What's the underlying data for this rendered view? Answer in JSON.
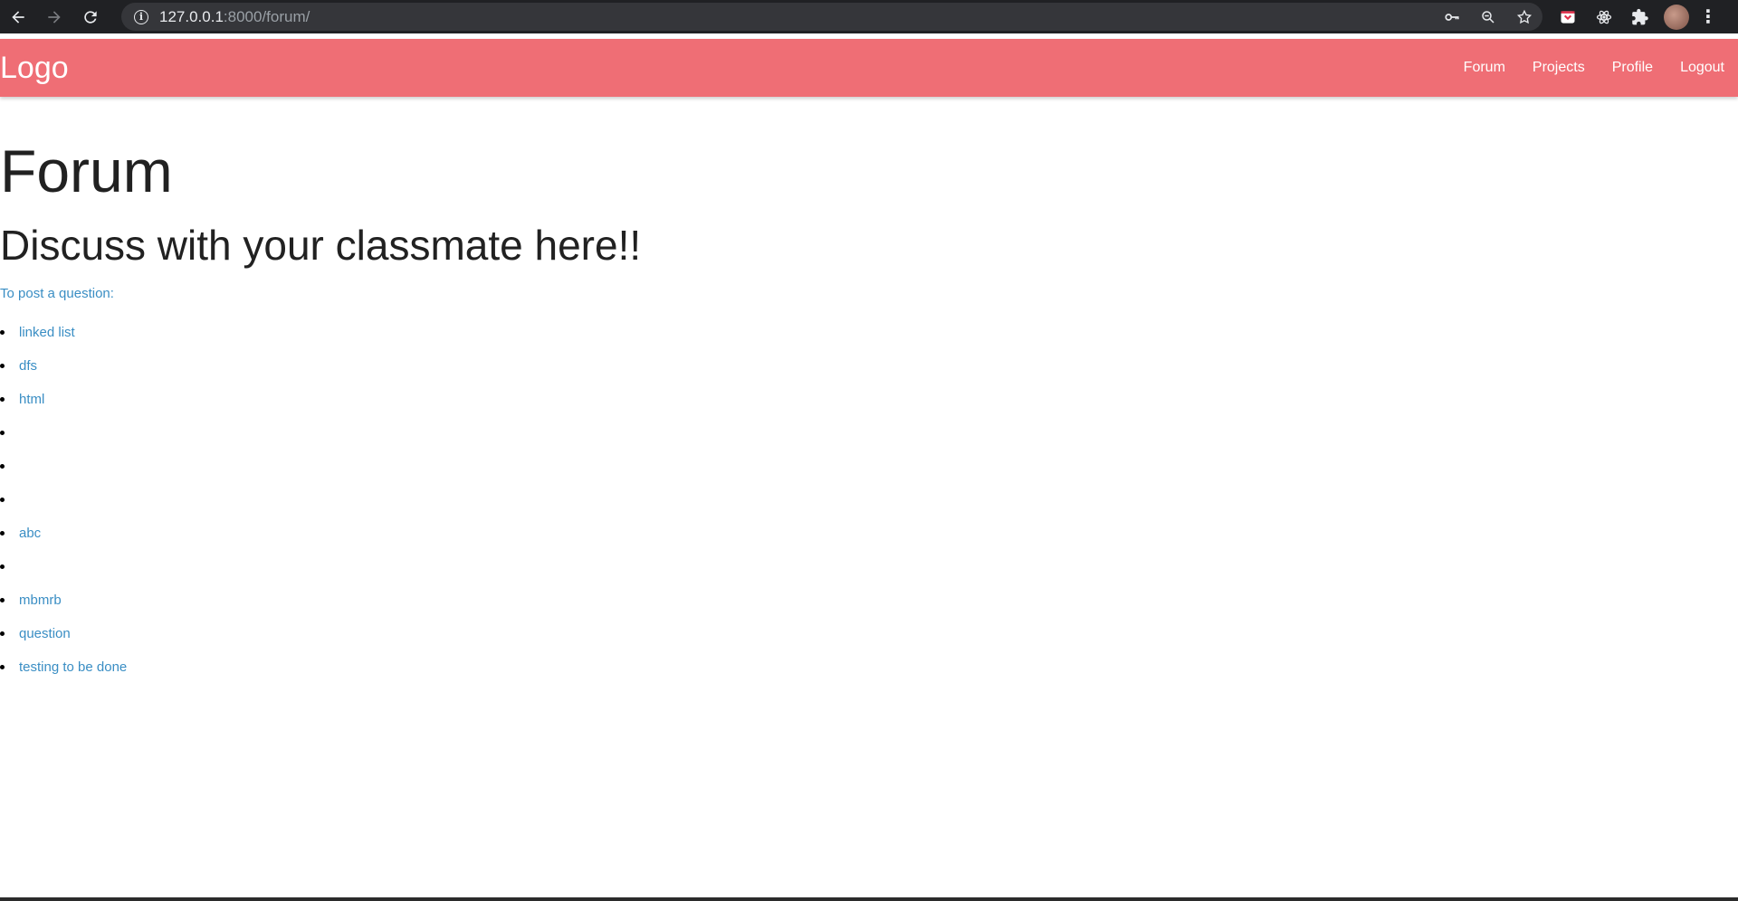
{
  "browser": {
    "url_host": "127.0.0.1",
    "url_rest": ":8000/forum/"
  },
  "nav": {
    "logo": "Logo",
    "links": [
      "Forum",
      "Projects",
      "Profile",
      "Logout"
    ]
  },
  "page": {
    "title": "Forum",
    "subtitle": "Discuss with your classmate here!!",
    "post_link": "To post a question:"
  },
  "questions": [
    "linked list",
    "dfs",
    "html",
    "",
    "",
    "",
    "abc",
    "",
    "mbmrb",
    "question",
    "testing to be done"
  ]
}
